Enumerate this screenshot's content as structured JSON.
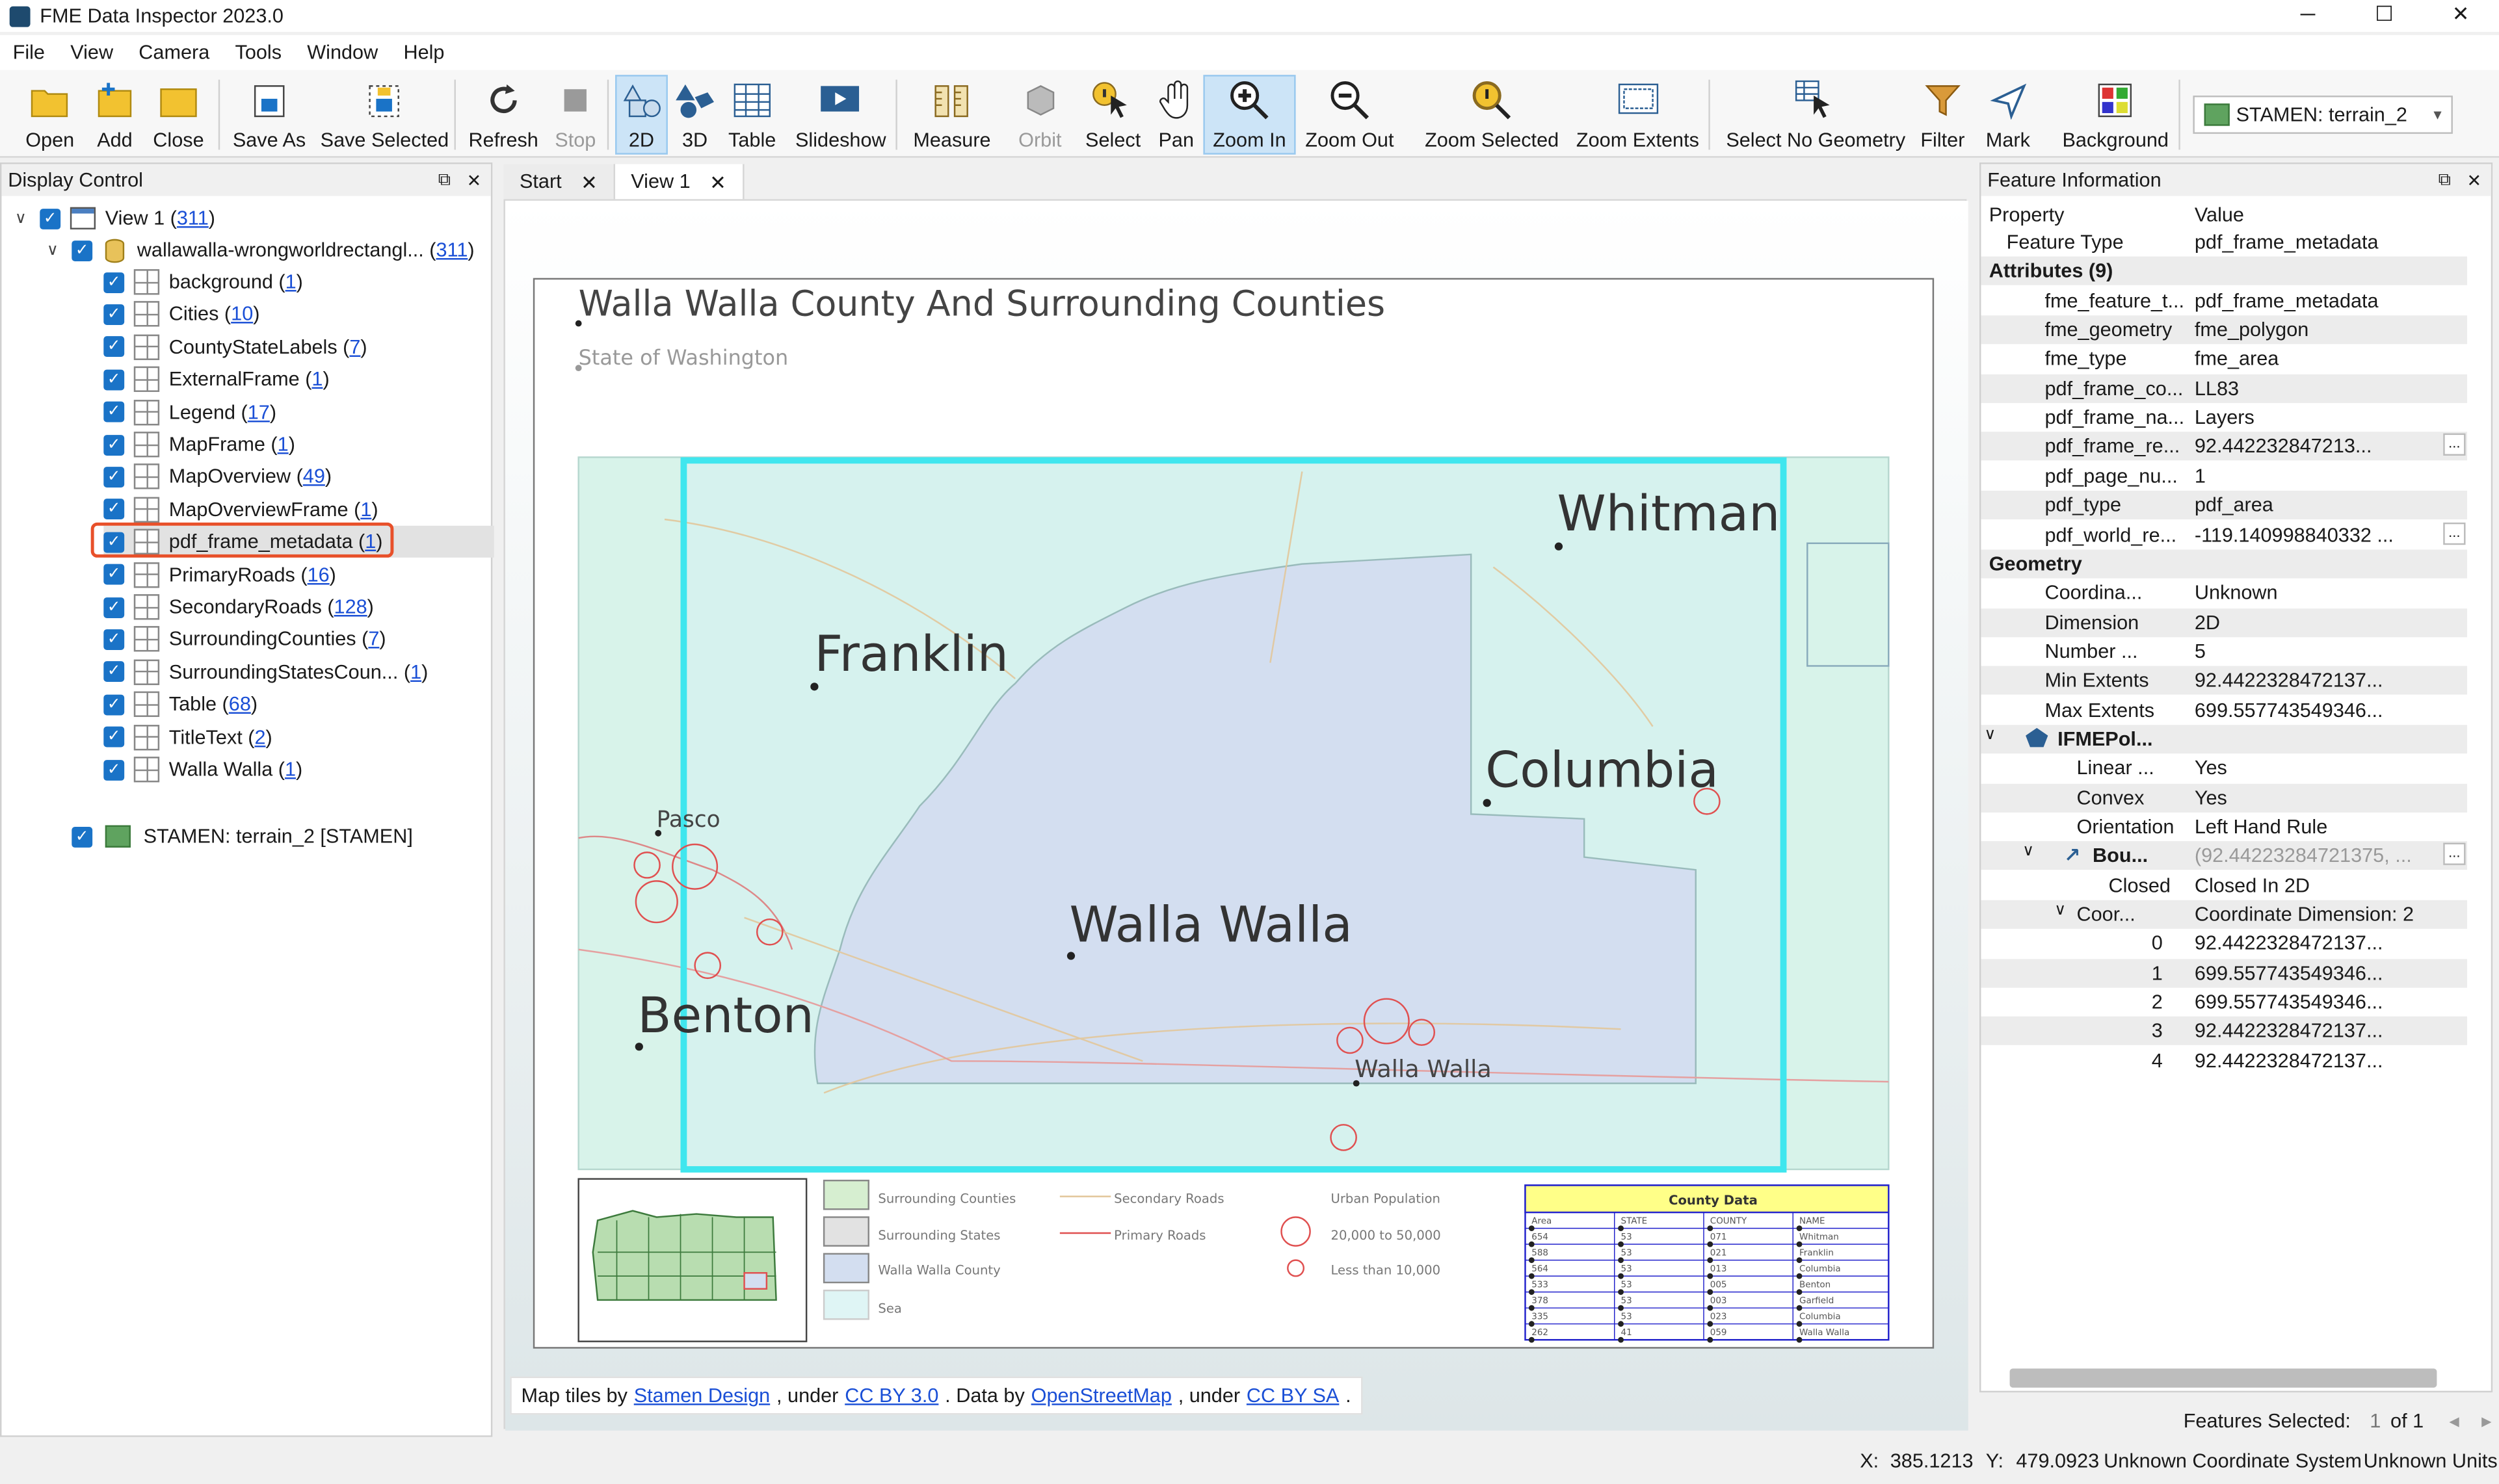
{
  "app": {
    "title": "FME Data Inspector 2023.0",
    "win_min": "─",
    "win_max": "☐",
    "win_close": "✕"
  },
  "menu": [
    "File",
    "View",
    "Camera",
    "Tools",
    "Window",
    "Help"
  ],
  "toolbar": {
    "open": "Open",
    "add": "Add",
    "close": "Close",
    "save_as": "Save As",
    "save_selected": "Save Selected",
    "refresh": "Refresh",
    "stop": "Stop",
    "btn_2d": "2D",
    "btn_3d": "3D",
    "table": "Table",
    "slideshow": "Slideshow",
    "measure": "Measure",
    "orbit": "Orbit",
    "select": "Select",
    "pan": "Pan",
    "zoom_in": "Zoom In",
    "zoom_out": "Zoom Out",
    "zoom_selected": "Zoom Selected",
    "zoom_extents": "Zoom Extents",
    "select_no_geometry": "Select No Geometry",
    "filter": "Filter",
    "mark": "Mark",
    "background": "Background",
    "background_value": "STAMEN: terrain_2"
  },
  "display_control": {
    "header": "Display Control",
    "view": {
      "label": "View 1 (",
      "count": "311",
      "close": ")"
    },
    "dataset": {
      "label": "wallawalla-wrongworldrectangl... (",
      "count": "311",
      "close": ")"
    },
    "layers": [
      {
        "label": "background (",
        "count": "1"
      },
      {
        "label": "Cities (",
        "count": "10"
      },
      {
        "label": "CountyStateLabels (",
        "count": "7"
      },
      {
        "label": "ExternalFrame (",
        "count": "1"
      },
      {
        "label": "Legend (",
        "count": "17"
      },
      {
        "label": "MapFrame (",
        "count": "1"
      },
      {
        "label": "MapOverview (",
        "count": "49"
      },
      {
        "label": "MapOverviewFrame (",
        "count": "1"
      },
      {
        "label": "pdf_frame_metadata (",
        "count": "1"
      },
      {
        "label": "PrimaryRoads (",
        "count": "16"
      },
      {
        "label": "SecondaryRoads (",
        "count": "128"
      },
      {
        "label": "SurroundingCounties (",
        "count": "7"
      },
      {
        "label": "SurroundingStatesCoun... (",
        "count": "1"
      },
      {
        "label": "Table (",
        "count": "68"
      },
      {
        "label": "TitleText (",
        "count": "2"
      },
      {
        "label": "Walla Walla (",
        "count": "1"
      }
    ],
    "close_paren": ")",
    "basemap": "STAMEN: terrain_2 [STAMEN]"
  },
  "tabs": [
    "Start",
    "View 1"
  ],
  "map": {
    "title": "Walla Walla County And Surrounding Counties",
    "subtitle": "State of Washington",
    "labels": {
      "whitman": "Whitman",
      "franklin": "Franklin",
      "columbia": "Columbia",
      "walla_walla": "Walla Walla",
      "benton": "Benton",
      "pasco": "Pasco",
      "ww_city": "Walla Walla"
    },
    "legend": {
      "surrounding_counties": "Surrounding Counties",
      "surrounding_states": "Surrounding States",
      "walla_walla_county": "Walla Walla County",
      "sea": "Sea",
      "secondary_roads": "Secondary Roads",
      "primary_roads": "Primary Roads",
      "urban_population": "Urban Population",
      "pop_large": "20,000 to 50,000",
      "pop_small": "Less than 10,000"
    },
    "county_table": {
      "title": "County Data",
      "headers": [
        "Area",
        "STATE",
        "COUNTY",
        "NAME"
      ],
      "rows": [
        [
          "654",
          "53",
          "071",
          "Whitman"
        ],
        [
          "588",
          "53",
          "021",
          "Franklin"
        ],
        [
          "564",
          "53",
          "013",
          "Columbia"
        ],
        [
          "533",
          "53",
          "005",
          "Benton"
        ],
        [
          "378",
          "53",
          "003",
          "Garfield"
        ],
        [
          "335",
          "53",
          "023",
          "Columbia"
        ],
        [
          "262",
          "41",
          "059",
          "Walla Walla"
        ]
      ]
    }
  },
  "attribution": {
    "p1": "Map tiles by",
    "l1": "Stamen Design",
    "p2": ", under",
    "l2": "CC BY 3.0",
    "p3": ". Data by",
    "l3": "OpenStreetMap",
    "p4": ", under",
    "l4": "CC BY SA",
    "p5": "."
  },
  "feature_info": {
    "header": "Feature Information",
    "col_property": "Property",
    "col_value": "Value",
    "rows": [
      {
        "k": "Feature Type",
        "v": "pdf_frame_metadata",
        "i": 1
      },
      {
        "k": "Attributes (9)",
        "v": "",
        "i": 0,
        "bold": true,
        "exp": "∨"
      },
      {
        "k": "fme_feature_t...",
        "v": "pdf_frame_metadata",
        "i": 2
      },
      {
        "k": "fme_geometry",
        "v": "fme_polygon",
        "i": 2
      },
      {
        "k": "fme_type",
        "v": "fme_area",
        "i": 2
      },
      {
        "k": "pdf_frame_co...",
        "v": "LL83",
        "i": 2
      },
      {
        "k": "pdf_frame_na...",
        "v": "Layers",
        "i": 2
      },
      {
        "k": "pdf_frame_re...",
        "v": "92.442232847213...",
        "i": 2,
        "more": true
      },
      {
        "k": "pdf_page_nu...",
        "v": "1",
        "i": 2
      },
      {
        "k": "pdf_type",
        "v": "pdf_area",
        "i": 2
      },
      {
        "k": "pdf_world_re...",
        "v": "-119.140998840332 ...",
        "i": 2,
        "more": true
      },
      {
        "k": "Geometry",
        "v": "",
        "i": 0,
        "bold": true,
        "exp": "∨"
      },
      {
        "k": "Coordina...",
        "v": "Unknown",
        "i": 2
      },
      {
        "k": "Dimension",
        "v": "2D",
        "i": 2
      },
      {
        "k": "Number ...",
        "v": "5",
        "i": 2
      },
      {
        "k": "Min Extents",
        "v": "92.4422328472137...",
        "i": 2
      },
      {
        "k": "Max Extents",
        "v": "699.557743549346...",
        "i": 2
      },
      {
        "k": "IFMEPol...",
        "v": "",
        "i": 1,
        "bold": true,
        "exp": "∨",
        "poly": true
      },
      {
        "k": "Linear ...",
        "v": "Yes",
        "i": 3
      },
      {
        "k": "Convex",
        "v": "Yes",
        "i": 3
      },
      {
        "k": "Orientation",
        "v": "Left Hand Rule",
        "i": 3
      },
      {
        "k": "Bou...",
        "v": "(92.44223284721375, ...",
        "i": 2,
        "bold": true,
        "exp": "∨",
        "line": true,
        "more": true,
        "grey": true
      },
      {
        "k": "Closed",
        "v": "Closed In 2D",
        "i": 4
      },
      {
        "k": "Coor...",
        "v": "Coordinate Dimension: 2",
        "i": 3,
        "exp": "∨"
      },
      {
        "k": "0",
        "v": "92.4422328472137...",
        "i": 5
      },
      {
        "k": "1",
        "v": "699.557743549346...",
        "i": 5
      },
      {
        "k": "2",
        "v": "699.557743549346...",
        "i": 5
      },
      {
        "k": "3",
        "v": "92.4422328472137...",
        "i": 5
      },
      {
        "k": "4",
        "v": "92.4422328472137...",
        "i": 5
      }
    ],
    "features_selected_label": "Features Selected:",
    "features_selected_index": "1",
    "features_selected_of": "of 1"
  },
  "status": {
    "x_label": "X:",
    "x": "385.1213",
    "y_label": "Y:",
    "y": "479.0923",
    "coord_sys": "Unknown Coordinate System",
    "units": "Unknown Units"
  }
}
